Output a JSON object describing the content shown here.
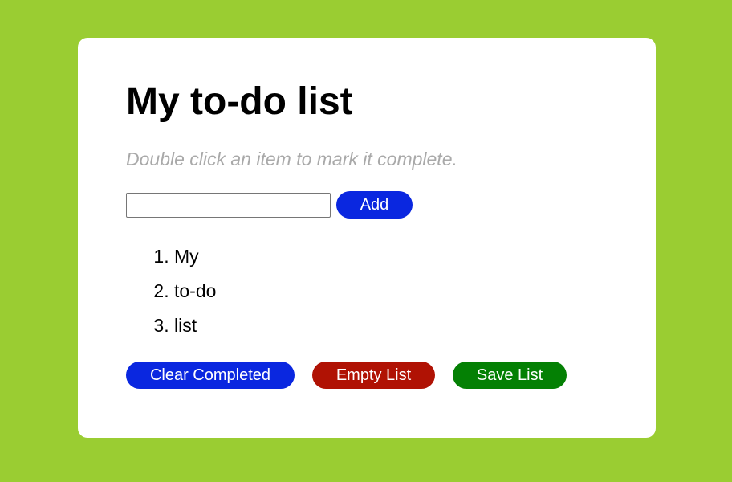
{
  "page": {
    "title": "My to-do list",
    "subtitle": "Double click an item to mark it complete."
  },
  "input": {
    "value": "",
    "placeholder": ""
  },
  "buttons": {
    "add": "Add",
    "clear_completed": "Clear Completed",
    "empty_list": "Empty List",
    "save_list": "Save List"
  },
  "items": [
    {
      "label": "My"
    },
    {
      "label": "to-do"
    },
    {
      "label": "list"
    }
  ],
  "colors": {
    "background": "#9acd32",
    "card": "#ffffff",
    "add_button": "#0a27e0",
    "clear_button": "#0a27e0",
    "empty_button": "#b01204",
    "save_button": "#048004",
    "subtitle": "#a9a9a9"
  }
}
